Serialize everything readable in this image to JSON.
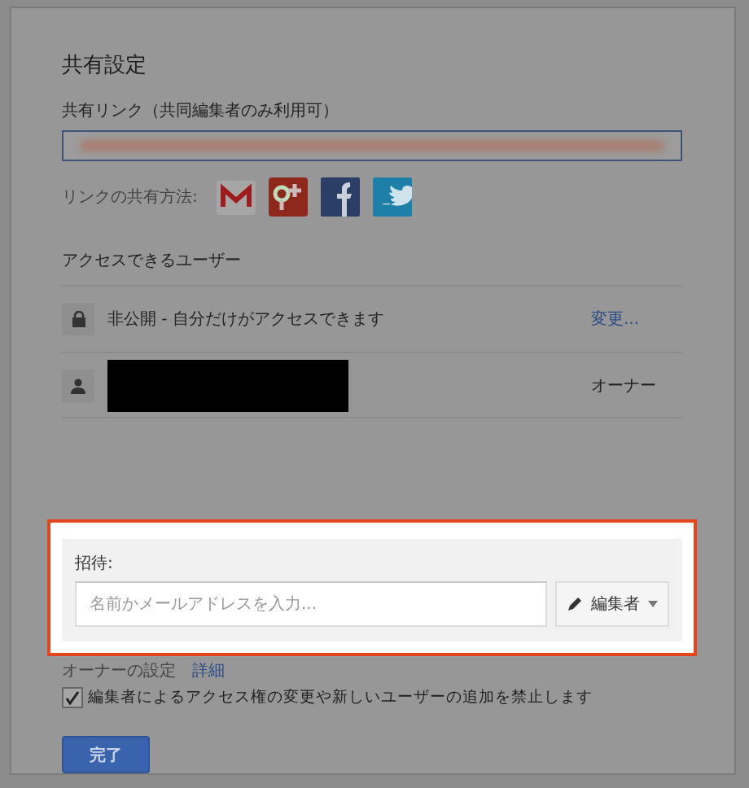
{
  "dialog": {
    "title": "共有設定",
    "share_link": {
      "label": "共有リンク（共同編集者のみ利用可）"
    },
    "share_via": {
      "label": "リンクの共有方法:",
      "services": [
        {
          "kind": "gmail"
        },
        {
          "kind": "google_plus"
        },
        {
          "kind": "facebook"
        },
        {
          "kind": "twitter"
        }
      ]
    },
    "access": {
      "heading": "アクセスできるユーザー",
      "rows": [
        {
          "kind": "visibility",
          "text": "非公開 - 自分だけがアクセスできます",
          "action": "変更..."
        },
        {
          "kind": "person",
          "role": "オーナー"
        }
      ]
    },
    "invite": {
      "label": "招待:",
      "placeholder": "名前かメールアドレスを入力...",
      "permission": "編集者"
    },
    "owner_settings": {
      "label": "オーナーの設定",
      "link": "詳細",
      "option": {
        "label": "編集者によるアクセス権の変更や新しいユーザーの追加を禁止します",
        "checked": true
      }
    },
    "done_button": "完了"
  }
}
